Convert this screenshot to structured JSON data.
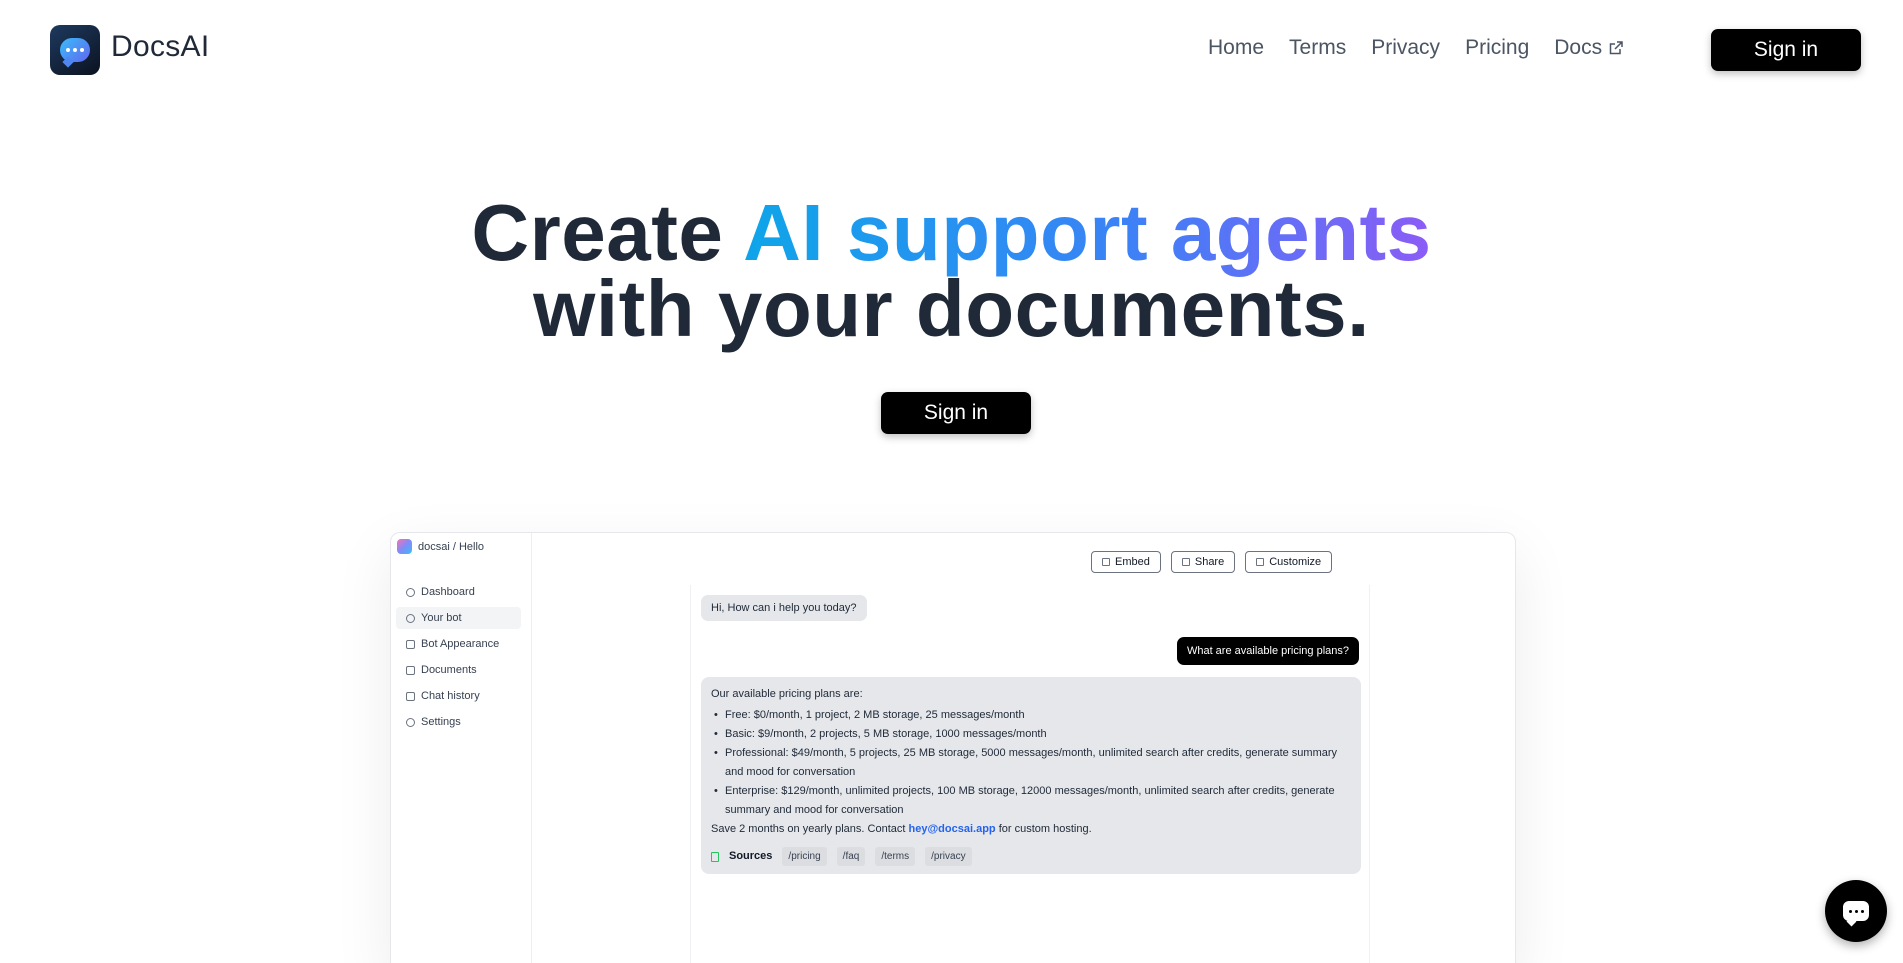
{
  "header": {
    "brand": "DocsAI",
    "nav": [
      "Home",
      "Terms",
      "Privacy",
      "Pricing",
      "Docs"
    ],
    "signin_label": "Sign in"
  },
  "hero": {
    "line1_plain": "Create",
    "line1_gradient": "AI support agents",
    "line2": "with your documents.",
    "cta_label": "Sign in"
  },
  "preview": {
    "workspace": "docsai / Hello",
    "menu": [
      "Dashboard",
      "Your bot",
      "Bot Appearance",
      "Documents",
      "Chat history",
      "Settings"
    ],
    "active_menu": "Your bot",
    "actions": [
      "Embed",
      "Share",
      "Customize"
    ],
    "greeting": "Hi, How can i help you today?",
    "user_question": "What are available pricing plans?",
    "answer_intro": "Our available pricing plans are:",
    "plans": [
      "Free: $0/month, 1 project, 2 MB storage, 25 messages/month",
      "Basic: $9/month, 2 projects, 5 MB storage, 1000 messages/month",
      "Professional: $49/month, 5 projects, 25 MB storage, 5000 messages/month, unlimited search after credits, generate summary and mood for conversation",
      "Enterprise: $129/month, unlimited projects, 100 MB storage, 12000 messages/month, unlimited search after credits, generate summary and mood for conversation"
    ],
    "save_text_before": "Save 2 months on yearly plans. Contact ",
    "contact_email": "hey@docsai.app",
    "save_text_after": " for custom hosting.",
    "sources_label": "Sources",
    "sources": [
      "/pricing",
      "/faq",
      "/terms",
      "/privacy"
    ]
  },
  "colors": {
    "accent_gradient_start": "#0ea5e9",
    "accent_gradient_end": "#8b5cf6",
    "button_bg": "#000000",
    "link": "#2563eb"
  },
  "icons": {
    "chat_fab": "chat-bubble-icon",
    "docs_external": "external-link-icon"
  }
}
